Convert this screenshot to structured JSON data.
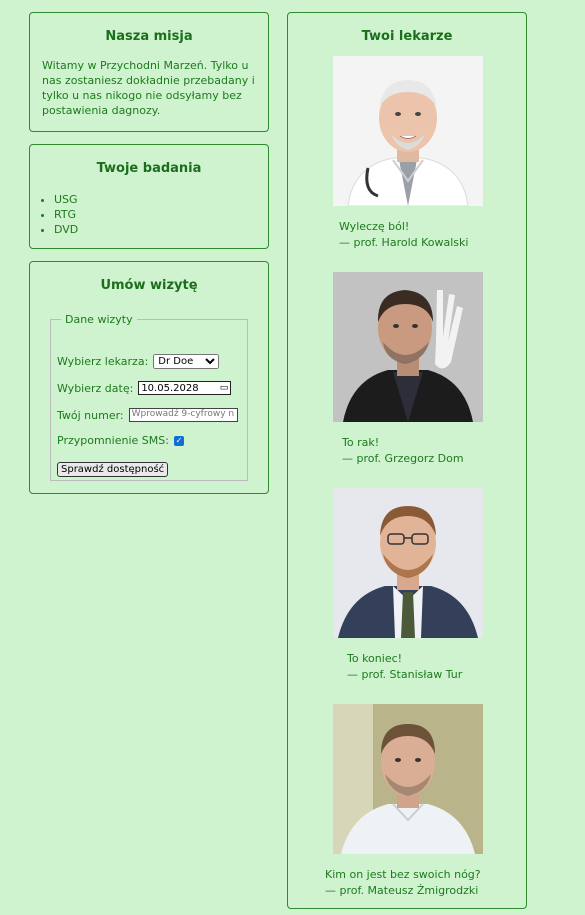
{
  "mission": {
    "title": "Nasza misja",
    "text": "Witamy w Przychodni Marzeń. Tylko u nas zostaniesz dokładnie przebadany i tylko u nas nikogo nie odsyłamy bez postawienia dagnozy."
  },
  "tests": {
    "title": "Twoje badania",
    "items": [
      "USG",
      "RTG",
      "DVD"
    ]
  },
  "appointment": {
    "title": "Umów wizytę",
    "legend": "Dane wizyty",
    "doctor_label": "Wybierz lekarza:",
    "doctor_value": "Dr Doe",
    "date_label": "Wybierz datę:",
    "date_value": "10.05.2028",
    "phone_label": "Twój numer:",
    "phone_placeholder": "Wprowadź 9-cyfrowy n",
    "sms_label": "Przypomnienie SMS:",
    "sms_checked": true,
    "button": "Sprawdź dostępność"
  },
  "doctors": {
    "title": "Twoi lekarze",
    "list": [
      {
        "quote": "Wyleczę ból!",
        "author": "— prof. Harold Kowalski"
      },
      {
        "quote": "To rak!",
        "author": "— prof. Grzegorz Dom"
      },
      {
        "quote": "To koniec!",
        "author": "— prof. Stanisław Tur"
      },
      {
        "quote": "Kim on jest bez swoich nóg?",
        "author": "— prof. Mateusz Żmigrodzki"
      }
    ]
  }
}
